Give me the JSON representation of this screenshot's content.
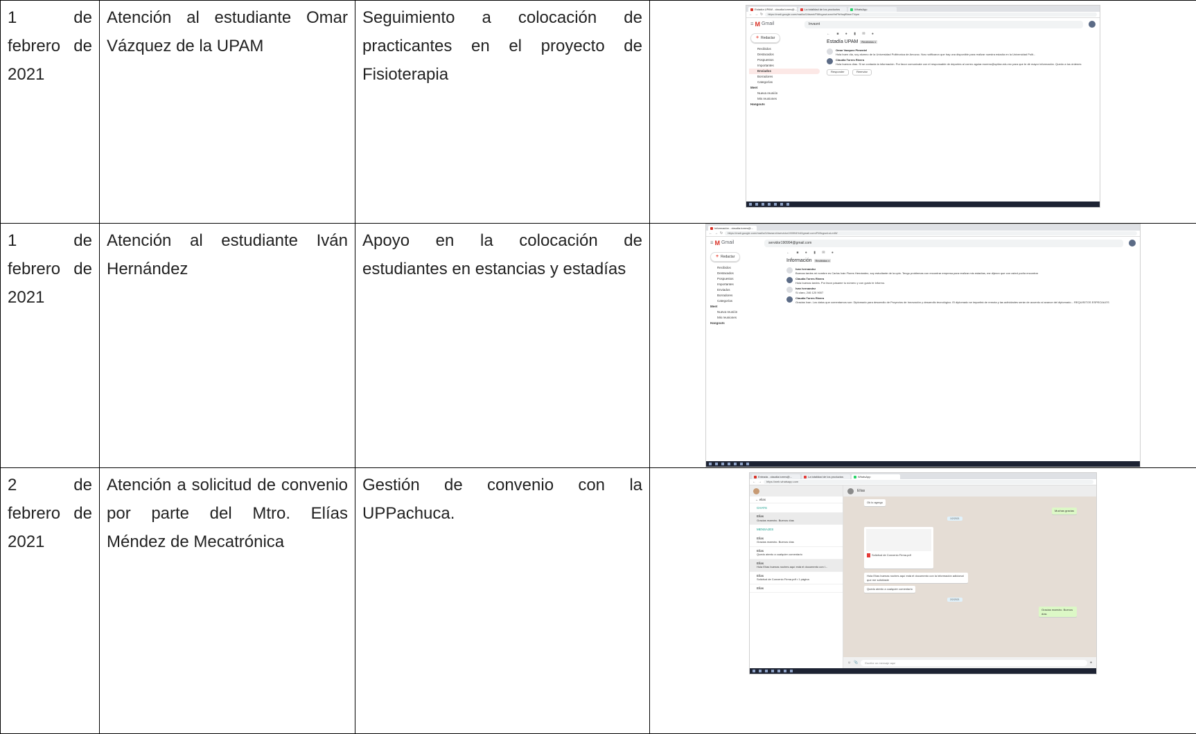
{
  "rows": [
    {
      "date": "1 de febrero de 2021",
      "attention": "Atención al estudiante Omar Vázquez de la UPAM",
      "activity": "Seguimiento a colocación de practicantes en el proyecto de Fisioterapia",
      "screenshot": {
        "tabs": [
          "Estadía UPAM - claudia.torres@...",
          "La totalidad de los productos",
          "WhatsApp"
        ],
        "url": "https://mail.google.com/mail/u/0/#sent/FMfcgxwLsmvHnPbHsqlBtnmTNpm",
        "app": "Gmail",
        "search": "Invasnt",
        "subject": "Estadía UPAM",
        "label": "Recibidos x",
        "sidebar": [
          "Recibidos",
          "Destacados",
          "Pospuestos",
          "Importantes",
          "Enviados",
          "Borradores",
          "Categorías"
        ],
        "meet_header": "Meet",
        "meet": [
          "Nueva reunión",
          "Mis reuniones"
        ],
        "hangouts_header": "Hangouts",
        "messages": [
          {
            "from": "Omar Vazquez Pimentel",
            "text": "Hola buen día, soy alumno de la Universidad Politécnica de Amozoc. Nos notificaron que hay una disponible para realizar nuestra estadía en la Universidad Polit..."
          },
          {
            "from": "Claudia Torres Rivera",
            "text": "Hola buenos días. Si se contacta la información. Por favor comunícate con el responsable de deportes al correo aguiar.moreno@uptlax.edu.mx para que te dé mayor información. Quedo a tus órdenes"
          }
        ],
        "reply": "Responder",
        "forward": "Reenviar"
      }
    },
    {
      "date": "1 de febrero de 2021",
      "attention": "Atención al estudiante Iván Hernández",
      "activity": "Apoyo en la colocación de estudiantes en estancias y estadías",
      "screenshot": {
        "tabs": [
          "Información - claudia.torres@..."
        ],
        "url": "https://mail.google.com/mail/u/0/#search/servidor190994%40gmail.com/FMfcgxwLsLmtW",
        "app": "Gmail",
        "search": "servidor190994@gmail.com",
        "subject": "Información",
        "label": "Recibidos x",
        "sidebar": [
          "Recibidos",
          "Destacados",
          "Pospuestos",
          "Importantes",
          "Enviados",
          "Borradores",
          "Categorías"
        ],
        "meet_header": "Meet",
        "meet": [
          "Nueva reunión",
          "Mis reuniones"
        ],
        "hangouts_header": "Hangouts",
        "messages": [
          {
            "from": "Ivan hernandez",
            "text": "Buenas tardes mi nombre es Carlos Iván Flores Hernández, soy estudiante de la uptx. Tengo problemas con encontrar empresa para realizar mis estadías, me dijeron que con usted podía encontrar"
          },
          {
            "from": "Claudia Torres Rivera",
            "text": "Hola buenas tardes. Por favor pásame tu número y con gusto te informo."
          },
          {
            "from": "Ivan hernandez",
            "text": "Sí claro, 246 120 9007"
          },
          {
            "from": "Claudia Torres Rivera",
            "text": "Gracias Ivan. Los datos que comentamos son: Diplomado para desarrollo de Proyectos de Innovación y desarrollo tecnológico. El diplomado se impartirá de remota y las actividades serán de acuerdo al avance del diplomado... REQUISITOS ESPECIALES"
          }
        ]
      }
    },
    {
      "date": "2 de febrero de 2021",
      "attention": "Atención a solicitud de convenio por parte del Mtro. Elías Méndez de Mecatrónica",
      "activity": "Gestión de convenio con la UPPachuca.",
      "screenshot": {
        "tabs": [
          "Entrada - claudia.torres@...",
          "La totalidad de los productos",
          "WhatsApp"
        ],
        "url": "https://web.whatsapp.com",
        "search": "elias",
        "contact": "Elías",
        "sections": [
          "CHATS",
          "MENSAJES"
        ],
        "chat_items": [
          {
            "name": "Elías",
            "text": "Gracias maestro. Buenos días"
          },
          {
            "name": "Elías",
            "text": "Gracias maestro. Buenos días"
          },
          {
            "name": "Elías",
            "text": "Quedo atento a cualquier comentario"
          },
          {
            "name": "Elías",
            "text": "Hola Elías buenas noches aquí está el documento con l..."
          },
          {
            "name": "Elías",
            "text": "Solicitud de Convenio Firma.pdf • 1 página"
          },
          {
            "name": "Elías",
            "text": ""
          }
        ],
        "bubbles": [
          {
            "text": "Ok lo agrego",
            "dir": "in"
          },
          {
            "text": "Muchas gracias",
            "dir": "out"
          },
          {
            "text": "Solicitud de Convenio Firma.pdf",
            "dir": "in"
          },
          {
            "text": "Hola Elías buenas noches aquí está el documento con la información adicional que me solicitaste",
            "dir": "in"
          },
          {
            "text": "Quedo atento a cualquier comentario",
            "dir": "in"
          },
          {
            "text": "Gracias maestro. Buenos días",
            "dir": "out"
          }
        ],
        "dates": [
          "1/2/2021",
          "2/2/2021"
        ],
        "input_placeholder": "Escribe un mensaje aquí"
      }
    }
  ]
}
